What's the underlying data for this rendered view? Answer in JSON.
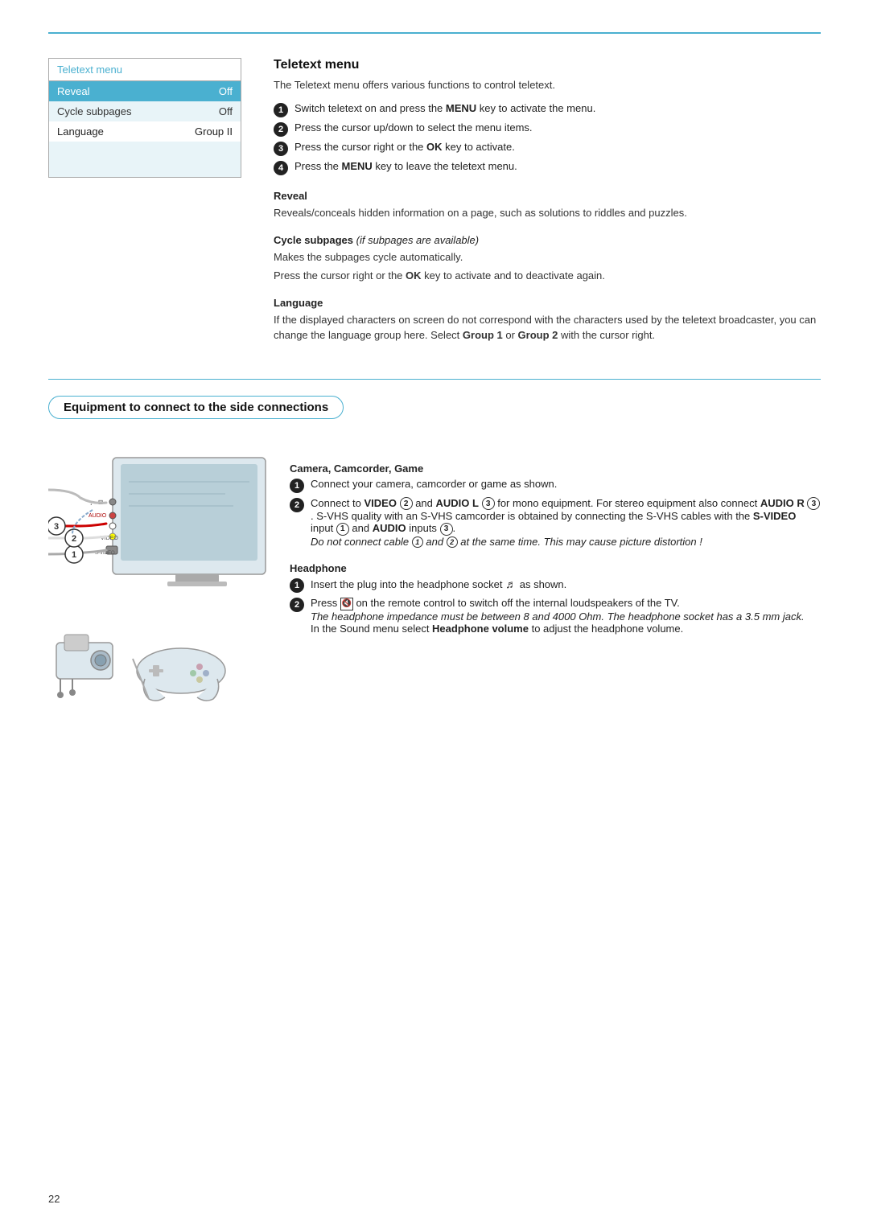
{
  "page": {
    "number": "22",
    "top_rule_color": "#4ab0d0"
  },
  "teletext_menu": {
    "title": "Teletext menu",
    "rows": [
      {
        "label": "Reveal",
        "value": "Off",
        "style": "highlighted"
      },
      {
        "label": "Cycle subpages",
        "value": "Off",
        "style": "alt"
      },
      {
        "label": "Language",
        "value": "Group II",
        "style": "normal"
      },
      {
        "label": "",
        "value": "",
        "style": "empty"
      },
      {
        "label": "",
        "value": "",
        "style": "empty"
      }
    ]
  },
  "teletext_section": {
    "title": "Teletext menu",
    "intro": "The Teletext menu offers various functions to control teletext.",
    "steps": [
      "Switch teletext on and press the MENU key to activate the menu.",
      "Press the cursor up/down to select the menu items.",
      "Press the cursor right or the OK key to activate.",
      "Press the MENU key to leave the teletext menu."
    ],
    "reveal": {
      "heading": "Reveal",
      "text": "Reveals/conceals hidden information on a page, such as solutions to riddles and puzzles."
    },
    "cycle_subpages": {
      "heading": "Cycle subpages",
      "italic_note": "(if subpages are available)",
      "text1": "Makes the subpages cycle automatically.",
      "text2": "Press the cursor right or the OK key to activate and to deactivate again."
    },
    "language": {
      "heading": "Language",
      "text": "If the displayed characters on screen do not correspond with the characters used by the teletext broadcaster, you can change the language group here. Select Group 1 or Group 2 with the cursor right."
    }
  },
  "equipment_section": {
    "title": "Equipment to connect to the side connections",
    "camera_heading": "Camera, Camcorder, Game",
    "camera_steps": [
      "Connect your camera, camcorder or game as shown.",
      "Connect to VIDEO ② and AUDIO L ③ for mono equipment. For stereo equipment also connect AUDIO R ③. S-VHS quality with an S-VHS camcorder is obtained by connecting the S-VHS cables with the S-VIDEO input ① and AUDIO inputs ③. Do not connect cable ① and ② at the same time. This may cause picture distortion !",
      ""
    ],
    "headphone_heading": "Headphone",
    "headphone_steps": [
      "Insert the plug into the headphone socket as shown.",
      "Press on the remote control to switch off the internal loudspeakers of the TV. The headphone impedance must be between 8 and 4000 Ohm. The headphone socket has a 3.5 mm jack. In the Sound menu select Headphone volume to adjust the headphone volume."
    ]
  }
}
